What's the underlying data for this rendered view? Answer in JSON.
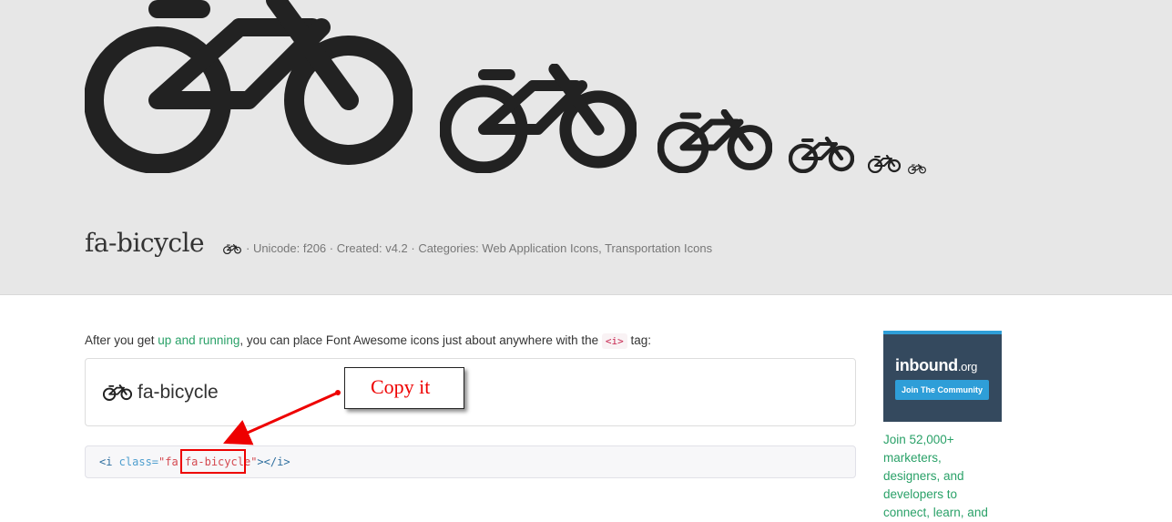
{
  "header": {
    "icon_name": "bicycle-icon",
    "title": "fa-bicycle",
    "meta": "· Unicode: f206 · Created: v4.2 · Categories: Web Application Icons, Transportation Icons"
  },
  "content": {
    "intro_before": "After you get ",
    "intro_link": "up and running",
    "intro_after": ", you can place Font Awesome icons just about anywhere with the ",
    "intro_code": "<i>",
    "intro_end": " tag:",
    "demo_label": "fa-bicycle",
    "code": {
      "open": "<i",
      "attr": " class=",
      "q1": "\"fa ",
      "cls": "fa-bicycle",
      "q2": "\"",
      "close": "></i>"
    }
  },
  "annotation": {
    "callout": "Copy it"
  },
  "sidebar": {
    "ad_logo": "inbound",
    "ad_logo_suffix": ".org",
    "ad_button": "Join The Community",
    "ad_text": "Join 52,000+ marketers, designers, and developers to connect, learn, and"
  },
  "colors": {
    "link": "#2aa168",
    "annotation": "#e00000",
    "ad_bg": "#34495e",
    "ad_accent": "#2e9ed8"
  }
}
